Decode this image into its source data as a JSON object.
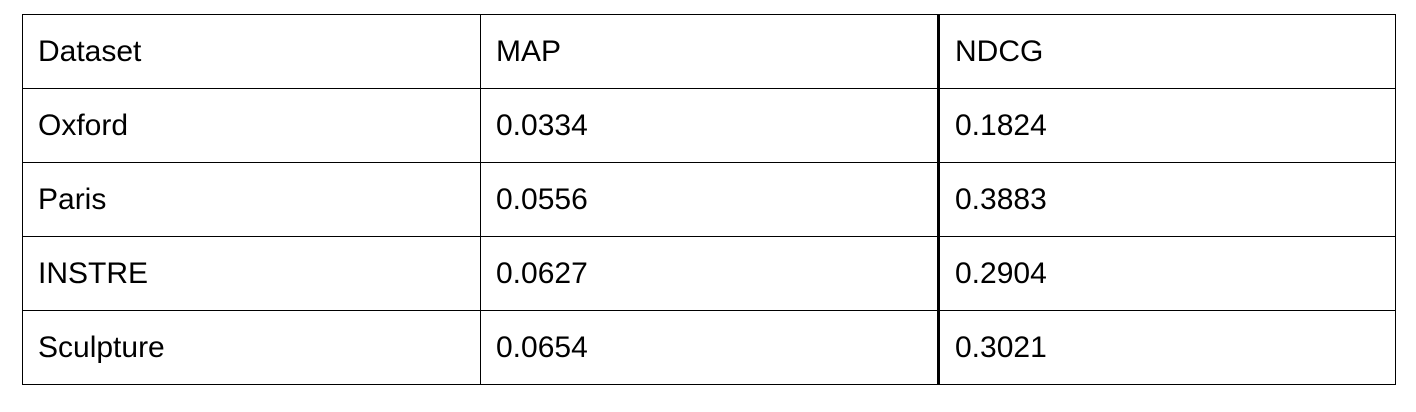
{
  "table": {
    "headers": [
      "Dataset",
      "MAP",
      "NDCG"
    ],
    "rows": [
      [
        "Oxford",
        "0.0334",
        "0.1824"
      ],
      [
        "Paris",
        "0.0556",
        "0.3883"
      ],
      [
        "INSTRE",
        "0.0627",
        "0.2904"
      ],
      [
        "Sculpture",
        "0.0654",
        "0.3021"
      ]
    ]
  }
}
